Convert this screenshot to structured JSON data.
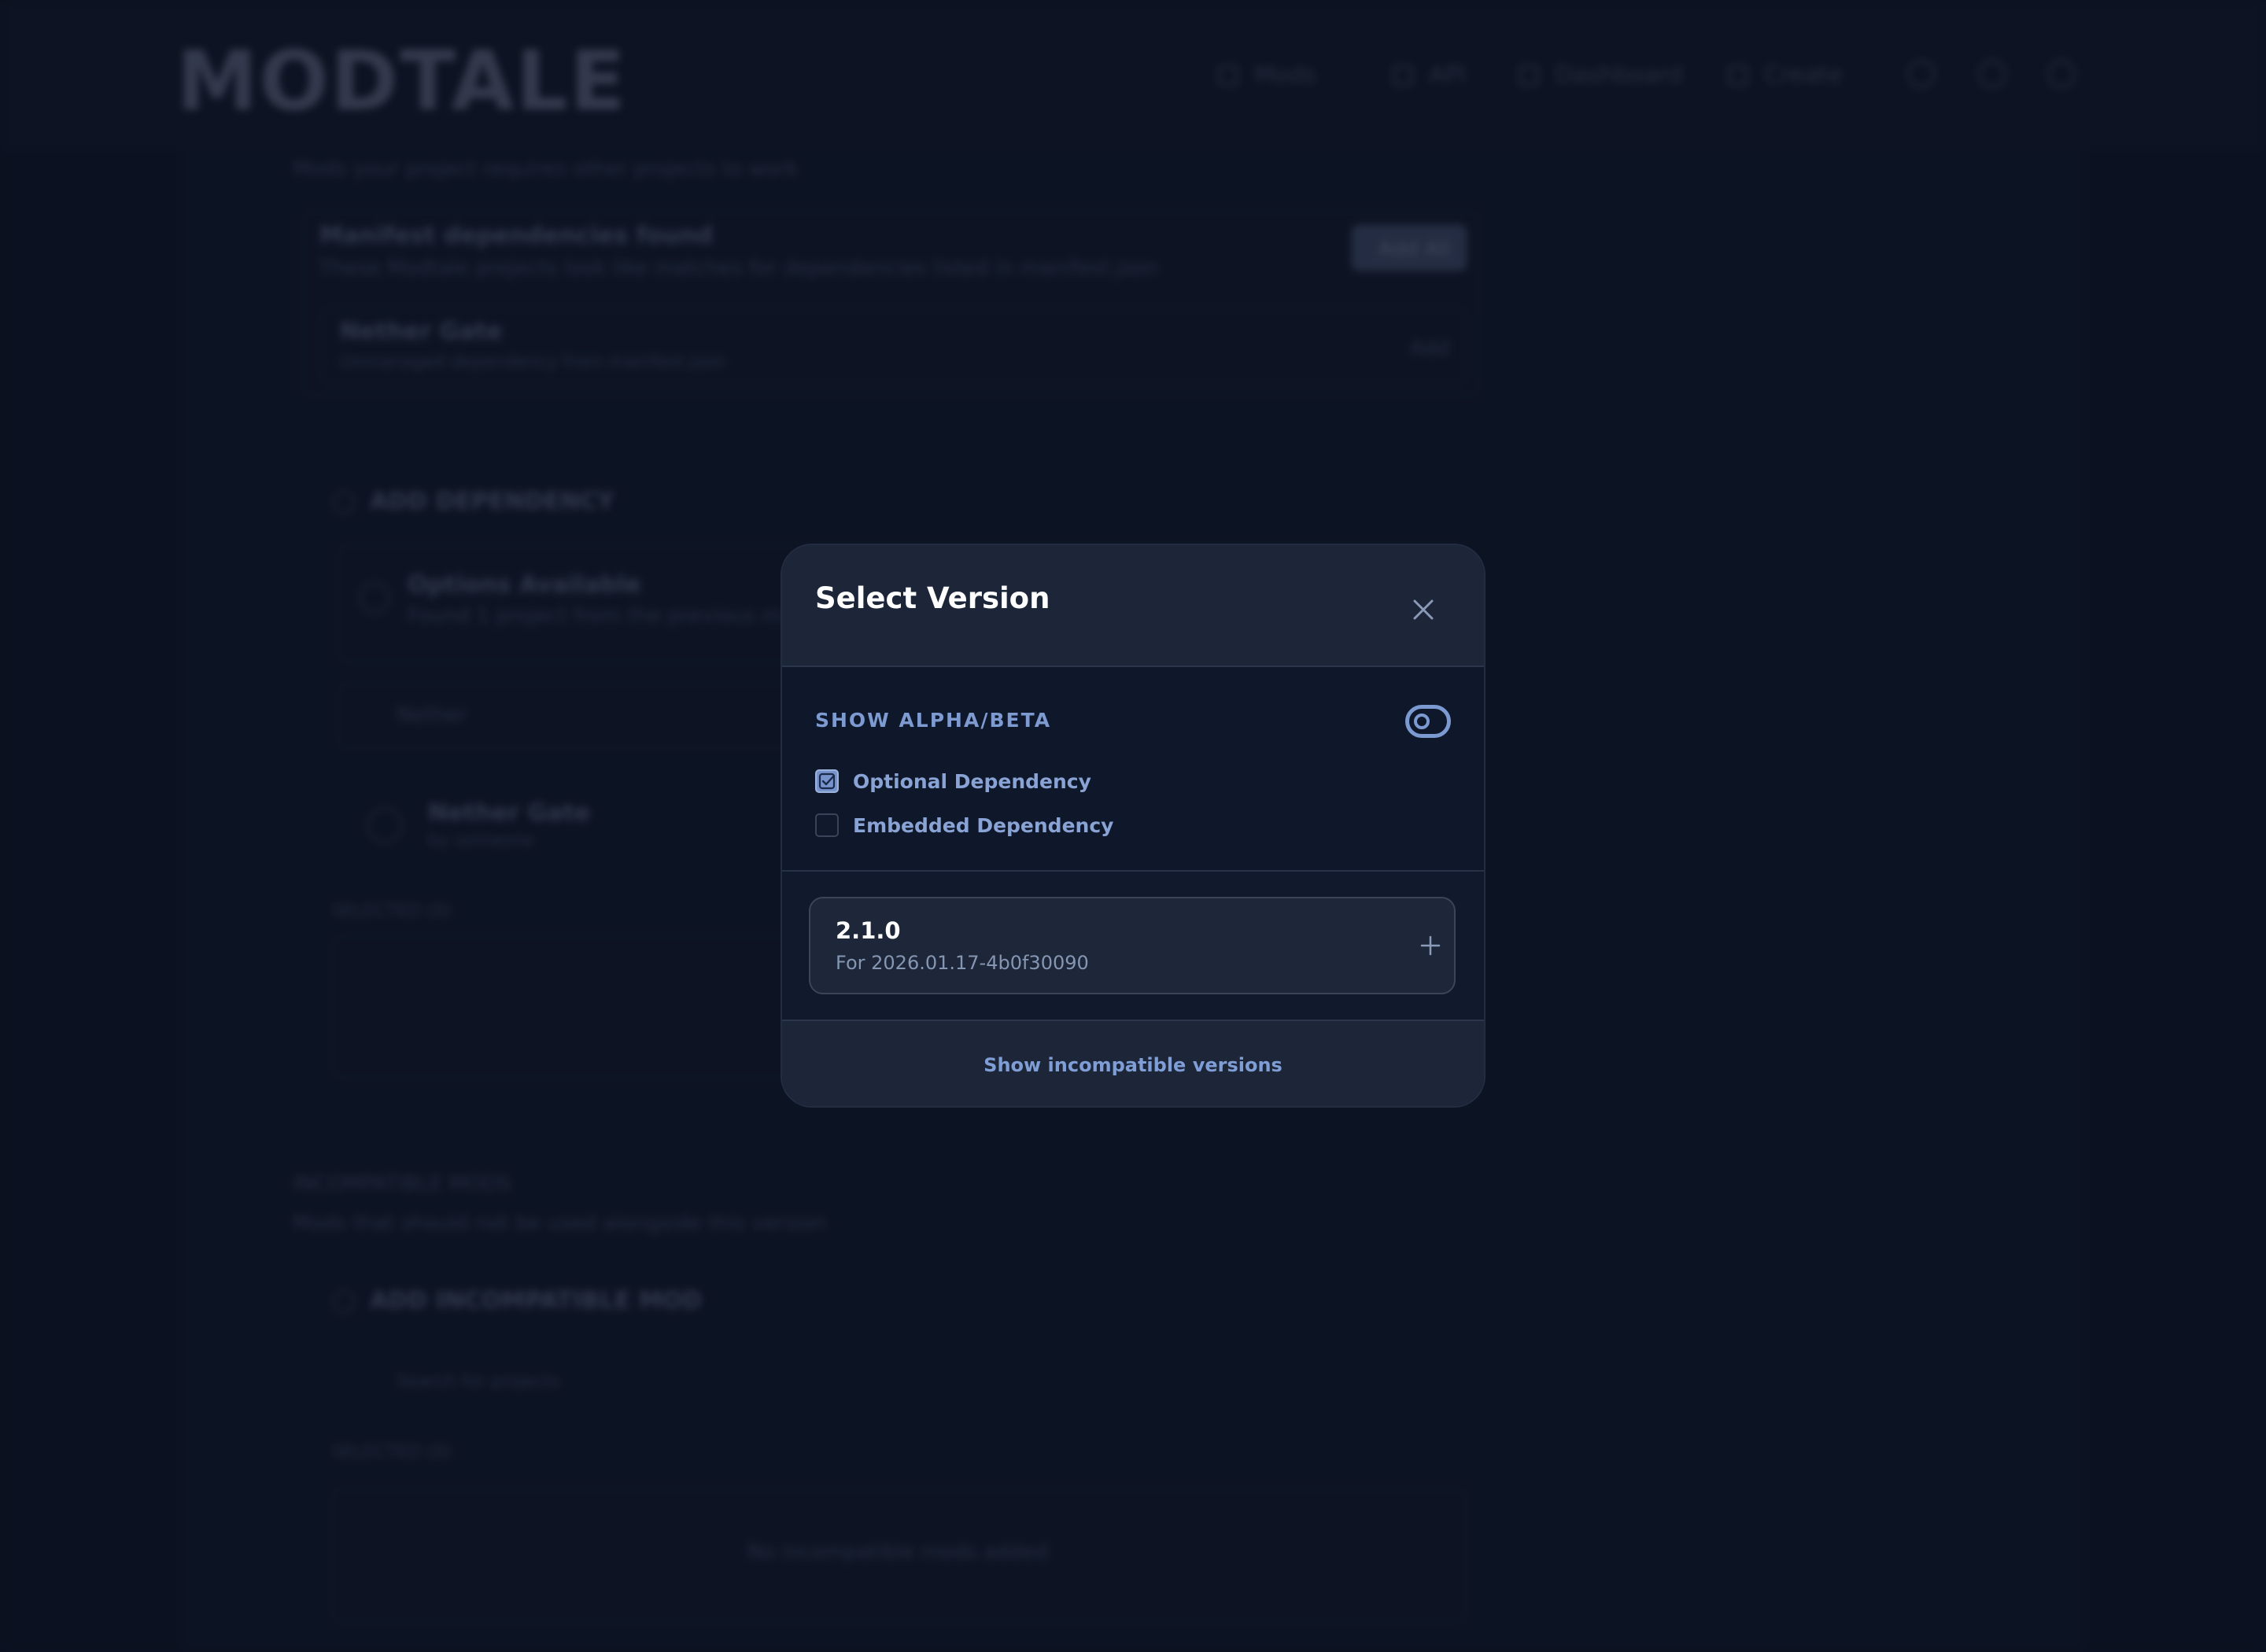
{
  "background": {
    "logo": "MODTALE",
    "nav": [
      "Mods",
      "API",
      "Dashboard",
      "Create"
    ],
    "subtitle": "Mods your project requires other projects to work",
    "manifest_title": "Manifest dependencies found",
    "manifest_desc": "These Modtale projects look like matches for dependencies listed in manifest.json",
    "manifest_button": "Add All",
    "manifest_item": "Nether Gate",
    "manifest_item_sub": "Unmanaged dependency from manifest.json",
    "manifest_item_action": "Add",
    "add_dependency": "ADD DEPENDENCY",
    "options_title": "Options Available",
    "options_desc": "Found 1 project from the previous manifest",
    "search_text": "Nether",
    "result_title": "Nether Gate",
    "result_sub": "by someone",
    "selected_label": "SELECTED (0)",
    "incompatible_title": "INCOMPATIBLE MODS",
    "incompatible_desc": "Mods that should not be used alongside this version",
    "add_incompatible": "ADD INCOMPATIBLE MOD",
    "search_projects": "Search for projects",
    "selected_label_2": "SELECTED (0)",
    "no_incompatible": "No incompatible mods added"
  },
  "modal": {
    "title": "Select Version",
    "close_icon": "close-icon",
    "alpha_beta_label": "SHOW ALPHA/BETA",
    "alpha_beta_enabled": false,
    "optional_label": "Optional Dependency",
    "optional_checked": true,
    "embedded_label": "Embedded Dependency",
    "embedded_checked": false,
    "versions": [
      {
        "number": "2.1.0",
        "for": "For 2026.01.17-4b0f30090"
      }
    ],
    "footer_link": "Show incompatible versions"
  },
  "colors": {
    "accent": "#7c9ad2",
    "page_bg": "#0f172a",
    "modal_header": "#1c2638"
  }
}
